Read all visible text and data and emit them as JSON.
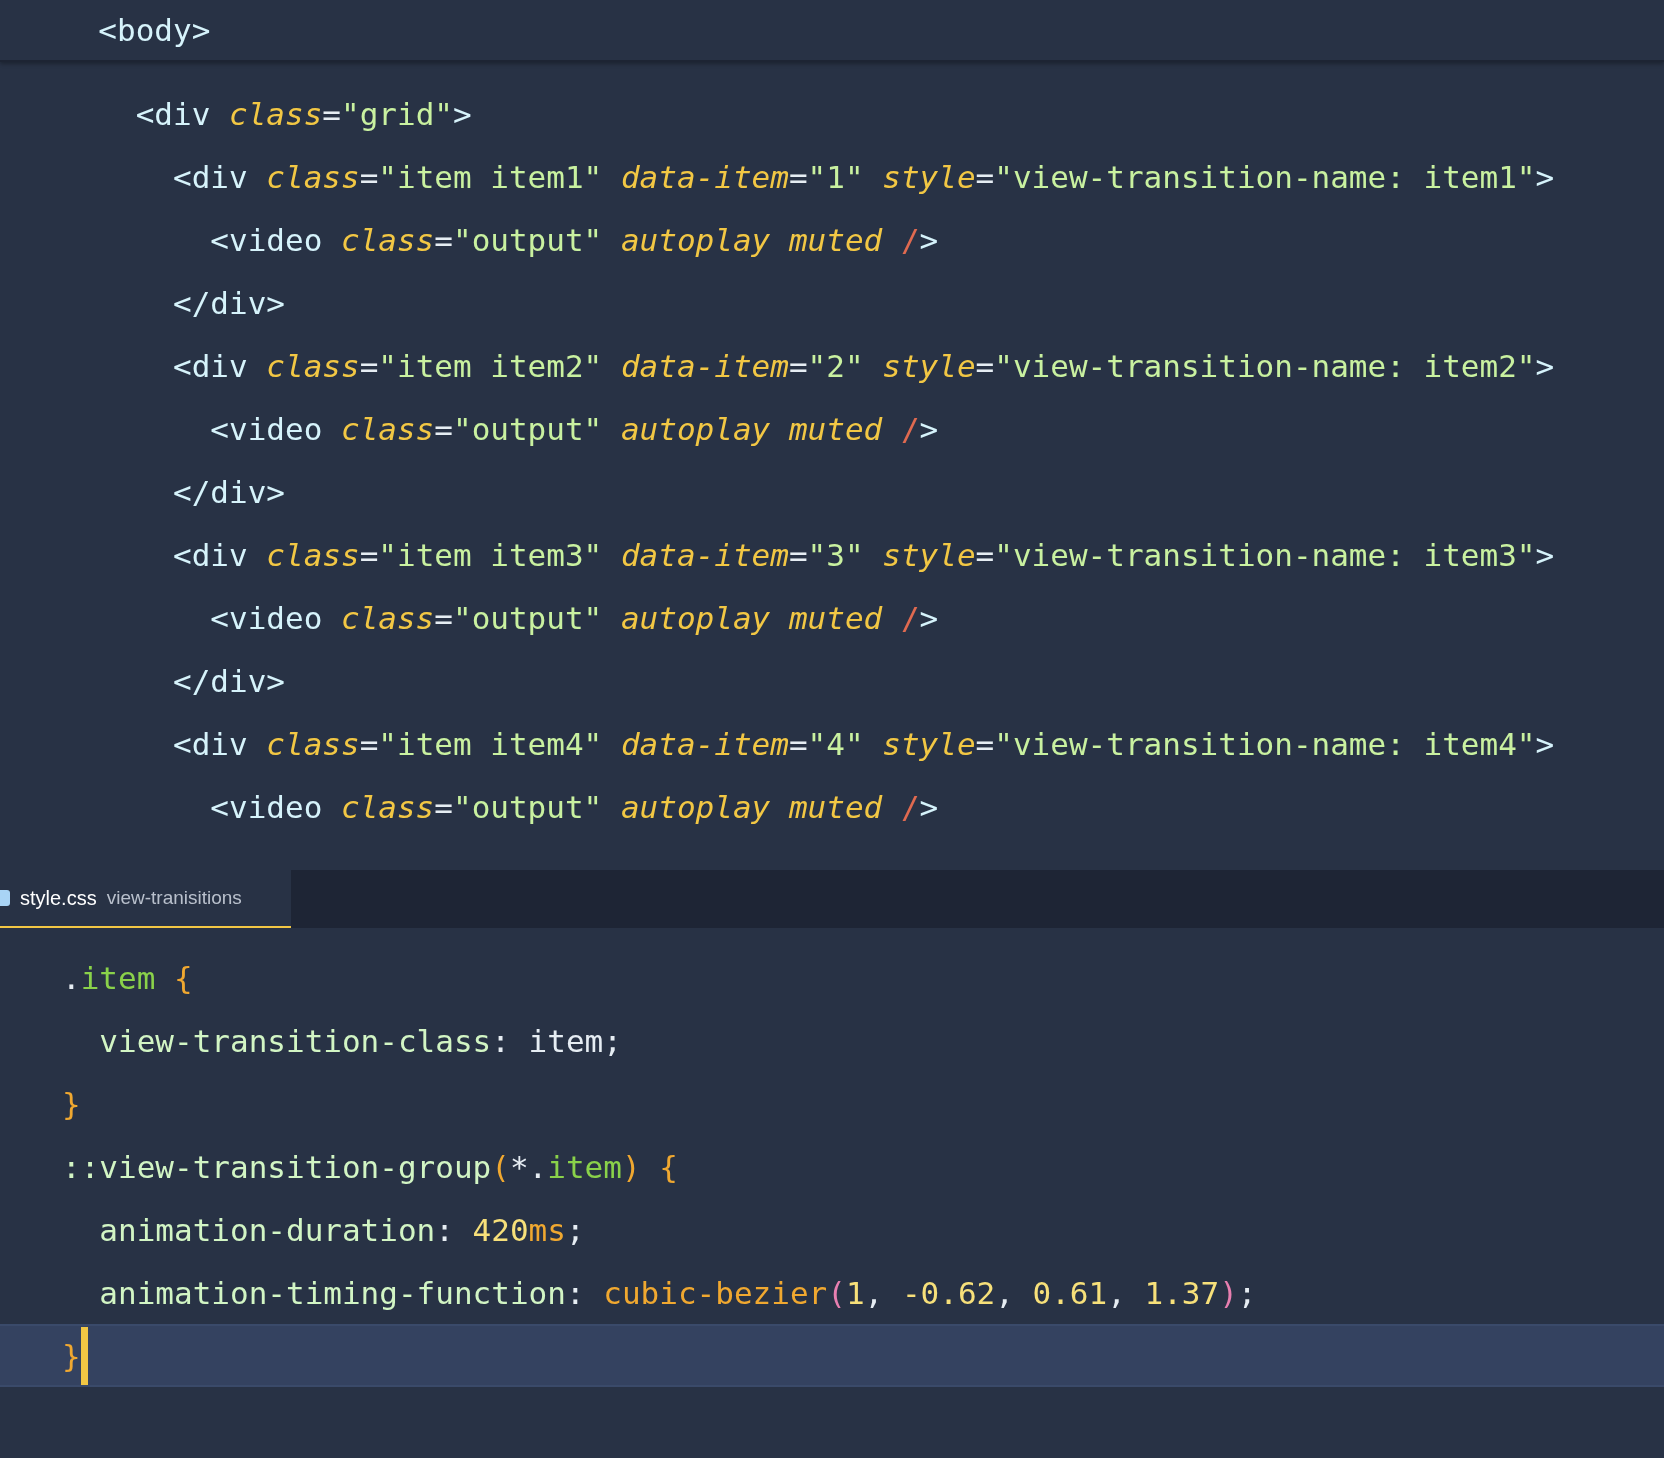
{
  "html_editor": {
    "sticky_line": [
      {
        "kind": "tag",
        "text": "  <body"
      },
      {
        "kind": "tag",
        "text": ">"
      }
    ],
    "lines": [
      {
        "tokens": [
          {
            "kind": "tag",
            "text": "    <div "
          },
          {
            "kind": "attr",
            "text": "class"
          },
          {
            "kind": "punct",
            "text": "="
          },
          {
            "kind": "string",
            "text": "\"grid\""
          },
          {
            "kind": "tag",
            "text": ">"
          }
        ]
      },
      {
        "tokens": [
          {
            "kind": "tag",
            "text": "      <div "
          },
          {
            "kind": "attr",
            "text": "class"
          },
          {
            "kind": "punct",
            "text": "="
          },
          {
            "kind": "string",
            "text": "\"item item1\" "
          },
          {
            "kind": "attr",
            "text": "data-item"
          },
          {
            "kind": "punct",
            "text": "="
          },
          {
            "kind": "string",
            "text": "\"1\" "
          },
          {
            "kind": "attr",
            "text": "style"
          },
          {
            "kind": "punct",
            "text": "="
          },
          {
            "kind": "string",
            "text": "\"view-transition-name: item1\""
          },
          {
            "kind": "tag",
            "text": ">"
          }
        ]
      },
      {
        "tokens": [
          {
            "kind": "tag",
            "text": "        <video "
          },
          {
            "kind": "attr",
            "text": "class"
          },
          {
            "kind": "punct",
            "text": "="
          },
          {
            "kind": "string",
            "text": "\"output\" "
          },
          {
            "kind": "attr",
            "text": "autoplay muted "
          },
          {
            "kind": "slash",
            "text": "/"
          },
          {
            "kind": "tag",
            "text": ">"
          }
        ]
      },
      {
        "tokens": [
          {
            "kind": "tag",
            "text": "      </div>"
          }
        ]
      },
      {
        "tokens": [
          {
            "kind": "tag",
            "text": "      <div "
          },
          {
            "kind": "attr",
            "text": "class"
          },
          {
            "kind": "punct",
            "text": "="
          },
          {
            "kind": "string",
            "text": "\"item item2\" "
          },
          {
            "kind": "attr",
            "text": "data-item"
          },
          {
            "kind": "punct",
            "text": "="
          },
          {
            "kind": "string",
            "text": "\"2\" "
          },
          {
            "kind": "attr",
            "text": "style"
          },
          {
            "kind": "punct",
            "text": "="
          },
          {
            "kind": "string",
            "text": "\"view-transition-name: item2\""
          },
          {
            "kind": "tag",
            "text": ">"
          }
        ]
      },
      {
        "tokens": [
          {
            "kind": "tag",
            "text": "        <video "
          },
          {
            "kind": "attr",
            "text": "class"
          },
          {
            "kind": "punct",
            "text": "="
          },
          {
            "kind": "string",
            "text": "\"output\" "
          },
          {
            "kind": "attr",
            "text": "autoplay muted "
          },
          {
            "kind": "slash",
            "text": "/"
          },
          {
            "kind": "tag",
            "text": ">"
          }
        ]
      },
      {
        "tokens": [
          {
            "kind": "tag",
            "text": "      </div>"
          }
        ]
      },
      {
        "tokens": [
          {
            "kind": "tag",
            "text": "      <div "
          },
          {
            "kind": "attr",
            "text": "class"
          },
          {
            "kind": "punct",
            "text": "="
          },
          {
            "kind": "string",
            "text": "\"item item3\" "
          },
          {
            "kind": "attr",
            "text": "data-item"
          },
          {
            "kind": "punct",
            "text": "="
          },
          {
            "kind": "string",
            "text": "\"3\" "
          },
          {
            "kind": "attr",
            "text": "style"
          },
          {
            "kind": "punct",
            "text": "="
          },
          {
            "kind": "string",
            "text": "\"view-transition-name: item3\""
          },
          {
            "kind": "tag",
            "text": ">"
          }
        ]
      },
      {
        "tokens": [
          {
            "kind": "tag",
            "text": "        <video "
          },
          {
            "kind": "attr",
            "text": "class"
          },
          {
            "kind": "punct",
            "text": "="
          },
          {
            "kind": "string",
            "text": "\"output\" "
          },
          {
            "kind": "attr",
            "text": "autoplay muted "
          },
          {
            "kind": "slash",
            "text": "/"
          },
          {
            "kind": "tag",
            "text": ">"
          }
        ]
      },
      {
        "tokens": [
          {
            "kind": "tag",
            "text": "      </div>"
          }
        ]
      },
      {
        "tokens": [
          {
            "kind": "tag",
            "text": "      <div "
          },
          {
            "kind": "attr",
            "text": "class"
          },
          {
            "kind": "punct",
            "text": "="
          },
          {
            "kind": "string",
            "text": "\"item item4\" "
          },
          {
            "kind": "attr",
            "text": "data-item"
          },
          {
            "kind": "punct",
            "text": "="
          },
          {
            "kind": "string",
            "text": "\"4\" "
          },
          {
            "kind": "attr",
            "text": "style"
          },
          {
            "kind": "punct",
            "text": "="
          },
          {
            "kind": "string",
            "text": "\"view-transition-name: item4\""
          },
          {
            "kind": "tag",
            "text": ">"
          }
        ]
      },
      {
        "tokens": [
          {
            "kind": "tag",
            "text": "        <video "
          },
          {
            "kind": "attr",
            "text": "class"
          },
          {
            "kind": "punct",
            "text": "="
          },
          {
            "kind": "string",
            "text": "\"output\" "
          },
          {
            "kind": "attr",
            "text": "autoplay muted "
          },
          {
            "kind": "slash",
            "text": "/"
          },
          {
            "kind": "tag",
            "text": ">"
          }
        ]
      }
    ]
  },
  "tab": {
    "filename": "style.css",
    "folder": "view-tranisitions",
    "selected": true
  },
  "css_editor": {
    "lines": [
      {
        "current": false,
        "tokens": [
          {
            "kind": "punct",
            "text": "."
          },
          {
            "kind": "selector",
            "text": "item "
          },
          {
            "kind": "brace",
            "text": "{"
          }
        ]
      },
      {
        "current": false,
        "tokens": [
          {
            "kind": "property",
            "text": "  view-transition-class"
          },
          {
            "kind": "punct",
            "text": ": item;"
          }
        ]
      },
      {
        "current": false,
        "tokens": [
          {
            "kind": "brace",
            "text": "}"
          }
        ]
      },
      {
        "current": false,
        "tokens": [
          {
            "kind": "property",
            "text": "::view-transition-group"
          },
          {
            "kind": "brace",
            "text": "("
          },
          {
            "kind": "punct",
            "text": "*."
          },
          {
            "kind": "selector",
            "text": "item"
          },
          {
            "kind": "brace",
            "text": ") {"
          }
        ]
      },
      {
        "current": false,
        "tokens": [
          {
            "kind": "property",
            "text": "  animation-duration"
          },
          {
            "kind": "punct",
            "text": ": "
          },
          {
            "kind": "number",
            "text": "420"
          },
          {
            "kind": "unit",
            "text": "ms"
          },
          {
            "kind": "punct",
            "text": ";"
          }
        ]
      },
      {
        "current": false,
        "tokens": [
          {
            "kind": "property",
            "text": "  animation-timing-function"
          },
          {
            "kind": "punct",
            "text": ": "
          },
          {
            "kind": "function",
            "text": "cubic-bezier"
          },
          {
            "kind": "paren",
            "text": "("
          },
          {
            "kind": "number",
            "text": "1"
          },
          {
            "kind": "punct",
            "text": ", "
          },
          {
            "kind": "number",
            "text": "-0.62"
          },
          {
            "kind": "punct",
            "text": ", "
          },
          {
            "kind": "number",
            "text": "0.61"
          },
          {
            "kind": "punct",
            "text": ", "
          },
          {
            "kind": "number",
            "text": "1.37"
          },
          {
            "kind": "paren",
            "text": ")"
          },
          {
            "kind": "punct",
            "text": ";"
          }
        ]
      },
      {
        "current": true,
        "tokens": [
          {
            "kind": "brace",
            "text": "}"
          }
        ]
      }
    ]
  }
}
